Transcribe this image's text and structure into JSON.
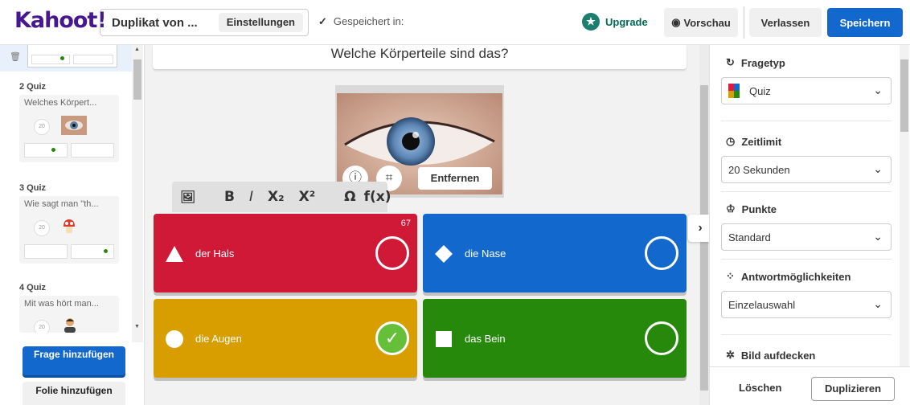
{
  "header": {
    "logo": "Kahoot!",
    "title": "Duplikat von ...",
    "settings_label": "Einstellungen",
    "saved_check": "✓",
    "saved_label": "Gespeichert in:",
    "upgrade_label": "Upgrade",
    "preview_label": "Vorschau",
    "exit_label": "Verlassen",
    "save_label": "Speichern"
  },
  "sidebar": {
    "slides": [
      {
        "label": "2 Quiz",
        "question": "Welches Körpert...",
        "timer": "20"
      },
      {
        "label": "3 Quiz",
        "question": "Wie sagt man \"th...",
        "timer": "20"
      },
      {
        "label": "4 Quiz",
        "question": "Mit was hört man...",
        "timer": "20"
      }
    ],
    "add_question": "Frage hinzufügen",
    "add_slide": "Folie hinzufügen"
  },
  "editor": {
    "question": "Welche Körperteile sind das?",
    "remove_image": "Entfernen",
    "format": {
      "image": "🖼",
      "bold": "B",
      "italic": "I",
      "subscript": "X₂",
      "superscript": "X²",
      "omega": "Ω",
      "fx": "f(x)"
    },
    "answers": [
      {
        "text": "der Hals",
        "color": "#d01937",
        "shape": "triangle",
        "char_count": "67",
        "correct": false
      },
      {
        "text": "die Nase",
        "color": "#1368ce",
        "shape": "diamond",
        "correct": false
      },
      {
        "text": "die Augen",
        "color": "#d89e00",
        "shape": "circle",
        "correct": true
      },
      {
        "text": "das Bein",
        "color": "#26890c",
        "shape": "square",
        "correct": false
      }
    ]
  },
  "settings_panel": {
    "question_type_label": "Fragetyp",
    "question_type_value": "Quiz",
    "time_limit_label": "Zeitlimit",
    "time_limit_value": "20 Sekunden",
    "points_label": "Punkte",
    "points_value": "Standard",
    "answer_options_label": "Antwortmöglichkeiten",
    "answer_options_value": "Einzelauswahl",
    "reveal_image_label": "Bild aufdecken",
    "delete_label": "Löschen",
    "duplicate_label": "Duplizieren"
  },
  "colors": {
    "brand": "#46178f",
    "primary": "#1368ce",
    "upgrade": "#026b52"
  },
  "icons": {
    "question_type": "refresh-icon",
    "time_limit": "clock-icon",
    "points": "medal-icon",
    "answer_options": "grid-dots-icon",
    "reveal_image": "sparkle-icon"
  }
}
